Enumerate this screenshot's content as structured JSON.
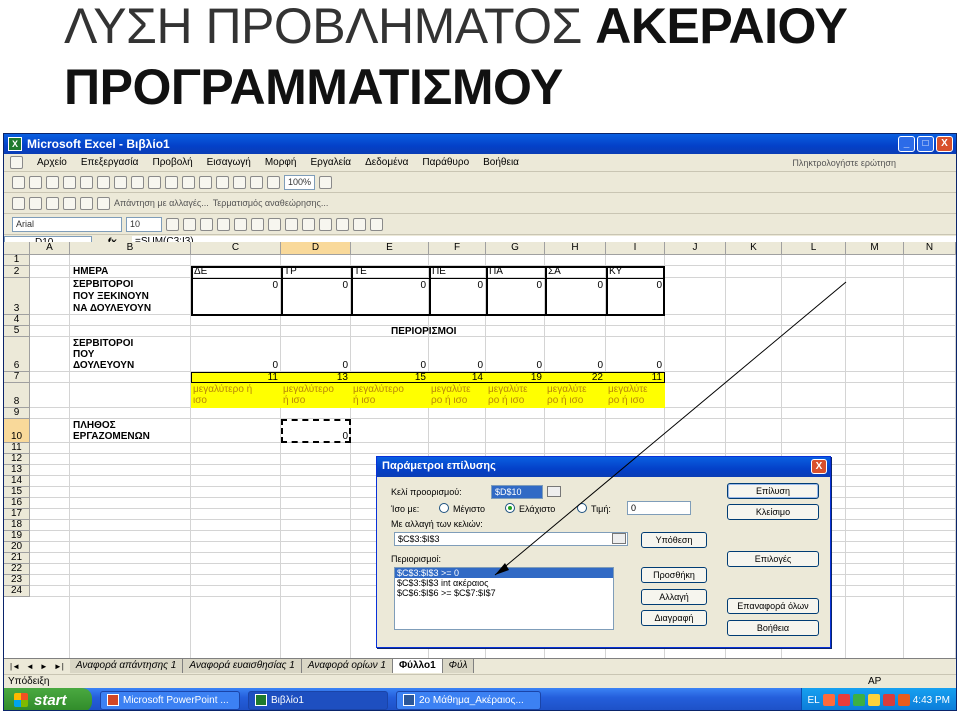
{
  "slide": {
    "title_line1_light": "ΛΥΣΗ ΠΡΟΒΛΗΜΑΤΟΣ ",
    "title_line1_bold": "ΑΚΕΡΑΙΟΥ",
    "title_line2": "ΠΡΟΓΡΑΜΜΑΤΙΣΜΟΥ"
  },
  "window": {
    "title": "Microsoft Excel - Βιβλίο1",
    "min": "_",
    "max": "□",
    "close": "X"
  },
  "menu": {
    "items": [
      "Αρχείο",
      "Επεξεργασία",
      "Προβολή",
      "Εισαγωγή",
      "Μορφή",
      "Εργαλεία",
      "Δεδομένα",
      "Παράθυρο",
      "Βοήθεια"
    ],
    "ask": "Πληκτρολογήστε ερώτηση"
  },
  "toolbar": {
    "zoom": "100%",
    "reply": "Απάντηση με αλλαγές...",
    "end_review": "Τερματισμός αναθεώρησης...",
    "font": "Arial",
    "size": "10"
  },
  "formula": {
    "namebox": "D10",
    "fx": "fx",
    "content": "=SUM(C3:I3)"
  },
  "columns": [
    "A",
    "B",
    "C",
    "D",
    "E",
    "F",
    "G",
    "H",
    "I",
    "J",
    "K",
    "L",
    "M",
    "N"
  ],
  "rows": [
    "1",
    "2",
    "3",
    "4",
    "5",
    "6",
    "7",
    "8",
    "9",
    "10",
    "11",
    "12",
    "13",
    "14",
    "15",
    "16",
    "17",
    "18",
    "19",
    "20",
    "21",
    "22",
    "23",
    "24"
  ],
  "sheet": {
    "b2": "ΗΜΕΡΑ",
    "days": [
      "ΔΕ",
      "ΤΡ",
      "ΤΕ",
      "ΠΕ",
      "ΠΑ",
      "ΣΑ",
      "ΚΥ"
    ],
    "b3": [
      "ΣΕΡΒΙΤΟΡΟΙ",
      "ΠΟΥ ΞΕΚΙΝΟΥΝ",
      "ΝΑ ΔΟΥΛΕΥΟΥΝ"
    ],
    "row3": [
      "0",
      "0",
      "0",
      "0",
      "0",
      "0",
      "0"
    ],
    "e5": "ΠΕΡΙΟΡΙΣΜΟΙ",
    "b6": [
      "ΣΕΡΒΙΤΟΡΟΙ",
      "ΠΟΥ",
      "ΔΟΥΛΕΥΟΥΝ"
    ],
    "row6": [
      "0",
      "0",
      "0",
      "0",
      "0",
      "0",
      "0"
    ],
    "row7": [
      "11",
      "13",
      "15",
      "14",
      "19",
      "22",
      "11"
    ],
    "row8": [
      [
        "μεγαλύτερο ή",
        "ισο"
      ],
      [
        "μεγαλύτερο",
        "ή ισο"
      ],
      [
        "μεγαλύτερο",
        "ή ισο"
      ],
      [
        "μεγαλύτε",
        "ρο ή ισο"
      ],
      [
        "μεγαλύτε",
        "ρο ή ισο"
      ],
      [
        "μεγαλύτε",
        "ρο ή ισο"
      ],
      [
        "μεγαλύτε",
        "ρο ή ισο"
      ]
    ],
    "b10": [
      "ΠΛΗΘΟΣ",
      "ΕΡΓΑΖΟΜΕΝΩΝ"
    ],
    "d10": "0"
  },
  "tabs": {
    "nav": [
      "|◄",
      "◄",
      "►",
      "►|"
    ],
    "items": [
      "Αναφορά απάντησης 1",
      "Αναφορά ευαισθησίας 1",
      "Αναφορά ορίων 1",
      "Φύλλο1",
      "Φύλ"
    ]
  },
  "status": {
    "left": "Υπόδειξη",
    "cap": "AP"
  },
  "taskbar": {
    "start": "start",
    "items": [
      "Microsoft PowerPoint ...",
      "Βιβλίο1",
      "2ο Μάθημα_Ακέραιος..."
    ],
    "lang": "EL",
    "time": "4:43 PM"
  },
  "dialog": {
    "title": "Παράμετροι επίλυσης",
    "close": "X",
    "target_label": "Κελί προορισμού:",
    "target_value": "$D$10",
    "equal_label": "Ίσο με:",
    "radio_max": "Μέγιστο",
    "radio_min": "Ελάχιστο",
    "radio_value": "Τιμή:",
    "value_input": "0",
    "changing_label": "Με αλλαγή των κελιών:",
    "changing_value": "$C$3:$I$3",
    "guess": "Υπόθεση",
    "constraints_label": "Περιορισμοί:",
    "constraints": [
      "$C$3:$I$3 >= 0",
      "$C$3:$I$3 int ακέραιος",
      "$C$6:$I$6 >= $C$7:$I$7"
    ],
    "add": "Προσθήκη",
    "change": "Αλλαγή",
    "delete": "Διαγραφή",
    "solve": "Επίλυση",
    "close_btn": "Κλείσιμο",
    "options": "Επιλογές",
    "reset": "Επαναφορά όλων",
    "help": "Βοήθεια"
  }
}
